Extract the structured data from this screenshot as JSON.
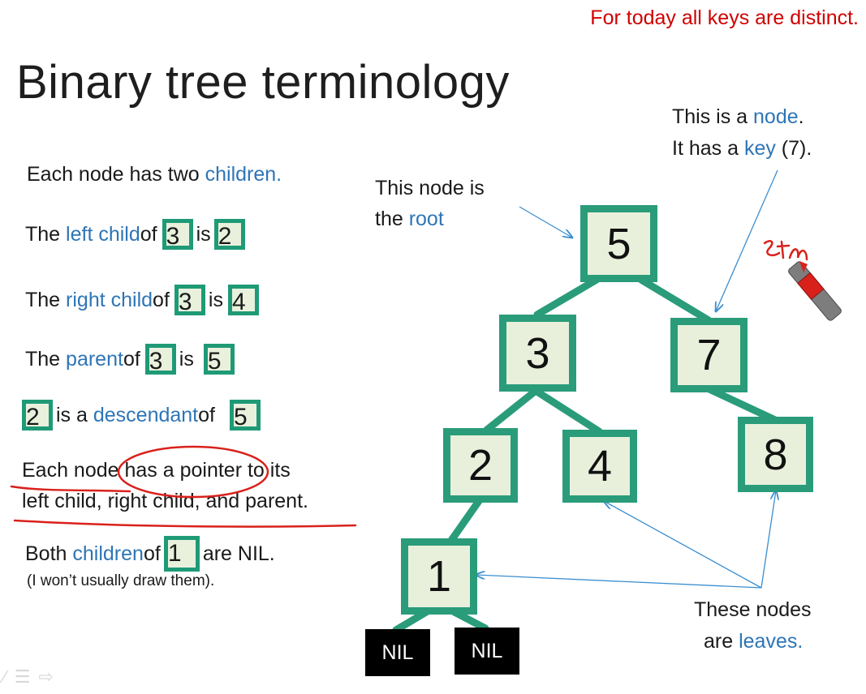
{
  "header": {
    "note": "For today all keys are distinct.",
    "title": "Binary tree terminology"
  },
  "defs": {
    "children_pre": "Each node has two ",
    "children_word": "children.",
    "left_pre": "The ",
    "left_word": "left child",
    "left_of": " of",
    "left_k1": "3",
    "left_is": " is",
    "left_k2": "2",
    "right_pre": "The ",
    "right_word": "right child",
    "right_of": " of",
    "right_k1": "3",
    "right_is": " is",
    "right_k2": "4",
    "parent_pre": "The ",
    "parent_word": "parent",
    "parent_of": " of",
    "parent_k1": "3",
    "parent_is": " is",
    "parent_k2": "5",
    "desc_k1": "2",
    "desc_pre": " is a ",
    "desc_word": "descendant",
    "desc_of": " of",
    "desc_k2": "5",
    "pointer_line1": "Each node has a pointer to its",
    "pointer_line2": "left child, right child, and parent.",
    "nil_pre": "Both ",
    "nil_word": "children",
    "nil_of": " of",
    "nil_k": "1",
    "nil_post": " are NIL.",
    "nil_note": "(I won’t usually draw them)."
  },
  "tree": {
    "root_label_1": "This node is",
    "root_label_2_pre": "the ",
    "root_label_2_word": "root",
    "node_label_1_pre": "This is a ",
    "node_label_1_word": "node",
    "node_label_1_post": ".",
    "node_label_2_pre": "It has a ",
    "node_label_2_word": "key",
    "node_label_2_post": " (7).",
    "leaves_label_1": "These nodes",
    "leaves_label_2_pre": "are ",
    "leaves_label_2_word": "leaves.",
    "nodes": {
      "n5": "5",
      "n3": "3",
      "n7": "7",
      "n2": "2",
      "n4": "4",
      "n8": "8",
      "n1": "1"
    },
    "nil_left": "NIL",
    "nil_right": "NIL"
  },
  "colors": {
    "node_border": "#2a9c7a",
    "node_fill": "#e8f0dc",
    "term_blue": "#2e75b6",
    "ink_red": "#d9211b",
    "top_note_red": "#d00000"
  }
}
